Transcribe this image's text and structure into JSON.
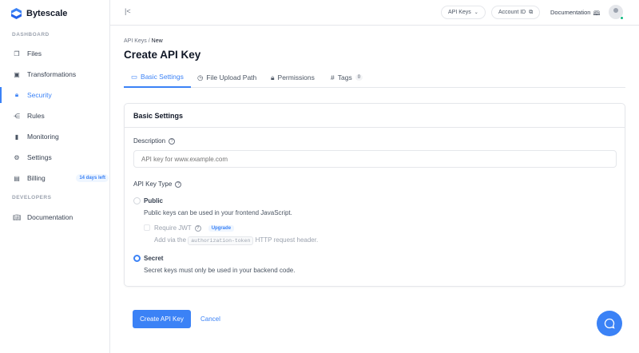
{
  "brand": "Bytescale",
  "sidebar": {
    "sections": [
      {
        "label": "DASHBOARD"
      },
      {
        "label": "DEVELOPERS"
      }
    ],
    "items": [
      {
        "label": "Files"
      },
      {
        "label": "Transformations"
      },
      {
        "label": "Security"
      },
      {
        "label": "Rules"
      },
      {
        "label": "Monitoring"
      },
      {
        "label": "Settings"
      },
      {
        "label": "Billing",
        "badge": "14 days left"
      },
      {
        "label": "Documentation"
      }
    ]
  },
  "topbar": {
    "api_keys": "API Keys",
    "account_id": "Account ID",
    "documentation": "Documentation"
  },
  "breadcrumb": {
    "parent": "API Keys",
    "sep": "/",
    "current": "New"
  },
  "title": "Create API Key",
  "tabs": [
    {
      "label": "Basic Settings"
    },
    {
      "label": "File Upload Path"
    },
    {
      "label": "Permissions"
    },
    {
      "label": "Tags",
      "count": "0"
    }
  ],
  "card": {
    "title": "Basic Settings",
    "description_label": "Description",
    "description_placeholder": "API key for www.example.com",
    "type_label": "API Key Type",
    "public": {
      "label": "Public",
      "desc": "Public keys can be used in your frontend JavaScript."
    },
    "jwt": {
      "label": "Require JWT",
      "badge": "Upgrade",
      "desc_pre": "Add via the",
      "code": "authorization-token",
      "desc_post": "HTTP request header."
    },
    "secret": {
      "label": "Secret",
      "desc": "Secret keys must only be used in your backend code."
    }
  },
  "actions": {
    "create": "Create API Key",
    "cancel": "Cancel"
  },
  "colors": {
    "accent": "#3b82f6"
  }
}
